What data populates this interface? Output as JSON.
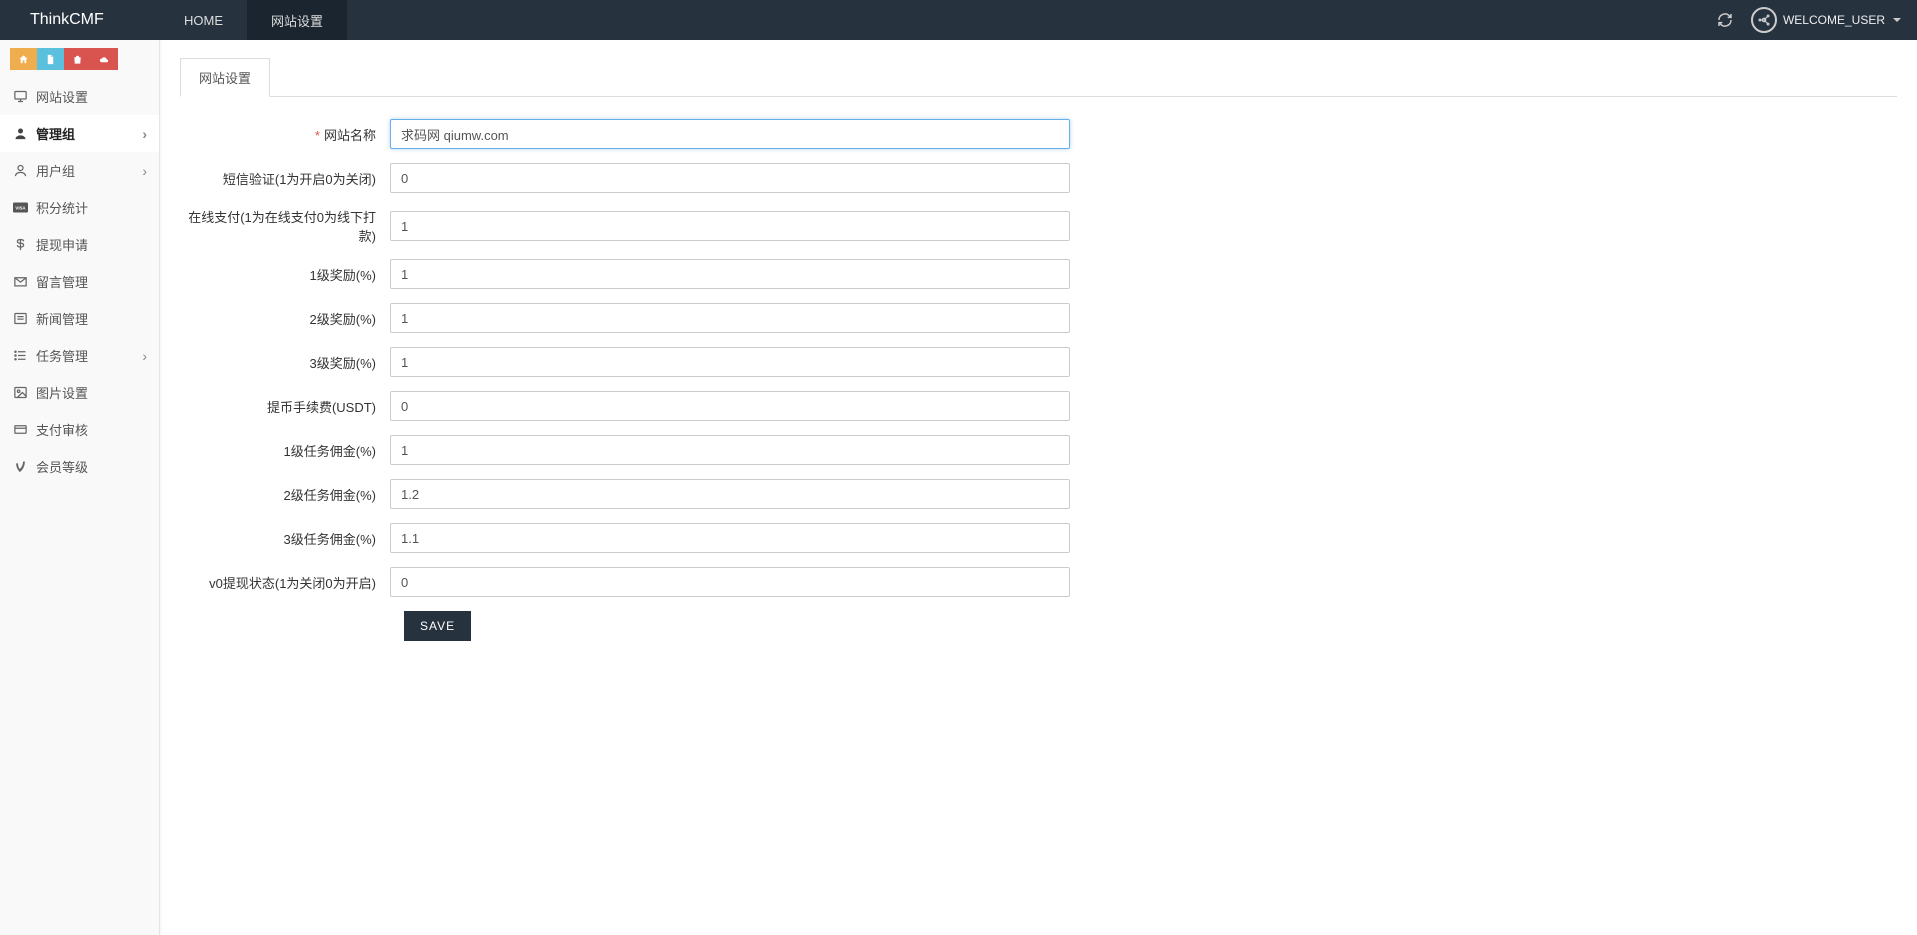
{
  "header": {
    "brand": "ThinkCMF",
    "tabs": [
      {
        "label": "HOME",
        "active": false
      },
      {
        "label": "网站设置",
        "active": true
      }
    ],
    "user_label": "WELCOME_USER"
  },
  "quicklinks": [
    {
      "name": "home-icon",
      "color": "orange"
    },
    {
      "name": "file-icon",
      "color": "blue"
    },
    {
      "name": "trash-icon",
      "color": "red"
    },
    {
      "name": "cloud-icon",
      "color": "darkred"
    }
  ],
  "sidebar": [
    {
      "name": "site-settings",
      "icon": "monitor-icon",
      "label": "网站设置",
      "chevron": false
    },
    {
      "name": "admin-group",
      "icon": "user-solid-icon",
      "label": "管理组",
      "chevron": true,
      "active": true
    },
    {
      "name": "user-group",
      "icon": "user-outline-icon",
      "label": "用户组",
      "chevron": true
    },
    {
      "name": "points-stats",
      "icon": "visa-icon",
      "label": "积分统计",
      "chevron": false
    },
    {
      "name": "withdraw-apply",
      "icon": "dollar-icon",
      "label": "提现申请",
      "chevron": false
    },
    {
      "name": "message-mgmt",
      "icon": "mail-icon",
      "label": "留言管理",
      "chevron": false
    },
    {
      "name": "news-mgmt",
      "icon": "news-icon",
      "label": "新闻管理",
      "chevron": false
    },
    {
      "name": "task-mgmt",
      "icon": "list-icon",
      "label": "任务管理",
      "chevron": true
    },
    {
      "name": "image-settings",
      "icon": "image-icon",
      "label": "图片设置",
      "chevron": false
    },
    {
      "name": "payment-review",
      "icon": "card-icon",
      "label": "支付审核",
      "chevron": false
    },
    {
      "name": "member-level",
      "icon": "vine-icon",
      "label": "会员等级",
      "chevron": false
    }
  ],
  "content": {
    "tab_label": "网站设置",
    "fields": [
      {
        "name": "site-name",
        "label": "网站名称",
        "value": "求码网 qiumw.com",
        "required": true
      },
      {
        "name": "sms-verify",
        "label": "短信验证(1为开启0为关闭)",
        "value": "0"
      },
      {
        "name": "online-pay",
        "label": "在线支付(1为在线支付0为线下打款)",
        "value": "1"
      },
      {
        "name": "reward-l1",
        "label": "1级奖励(%)",
        "value": "1"
      },
      {
        "name": "reward-l2",
        "label": "2级奖励(%)",
        "value": "1"
      },
      {
        "name": "reward-l3",
        "label": "3级奖励(%)",
        "value": "1"
      },
      {
        "name": "withdraw-fee",
        "label": "提币手续费(USDT)",
        "value": "0"
      },
      {
        "name": "task-comm-l1",
        "label": "1级任务佣金(%)",
        "value": "1"
      },
      {
        "name": "task-comm-l2",
        "label": "2级任务佣金(%)",
        "value": "1.2"
      },
      {
        "name": "task-comm-l3",
        "label": "3级任务佣金(%)",
        "value": "1.1"
      },
      {
        "name": "v0-withdraw",
        "label": "v0提现状态(1为关闭0为开启)",
        "value": "0"
      }
    ],
    "save_label": "SAVE"
  }
}
